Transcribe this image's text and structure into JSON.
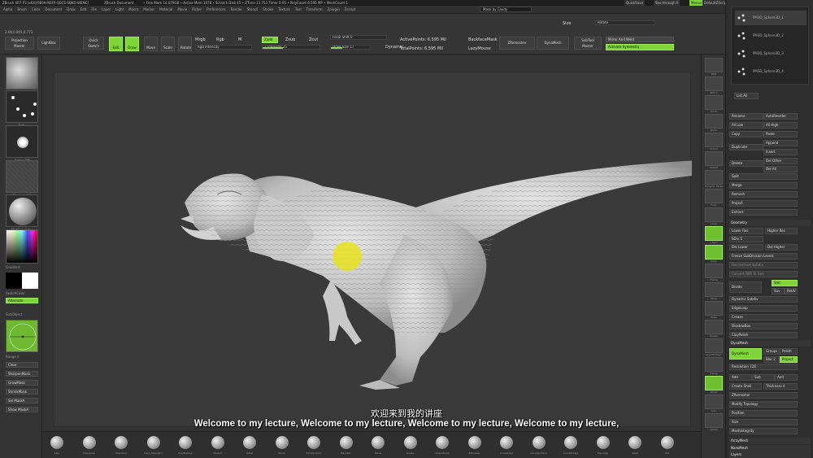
{
  "titlebar": {
    "app": "ZBrush 4R7 P3 (x64)[9E0H-NSFP-Q0CS-SQKO-WEMC]",
    "doc": "ZBrush Document",
    "stats": "• Free Mem 14.079GB • Active Mem 1078 • Scratch Disk 45 • ZTime 13.753 Timer 0.05 • PolyCount 6.595 MP • MeshCount 1",
    "quicksave": "QuickSave",
    "seethrough": "See-through  0",
    "menus": "Menus",
    "default_zscript": "DefaultZScript"
  },
  "menubar": {
    "items": [
      "Alpha",
      "Brush",
      "Color",
      "Document",
      "Draw",
      "Edit",
      "File",
      "Layer",
      "Light",
      "Macro",
      "Marker",
      "Material",
      "Movie",
      "Picker",
      "Preferences",
      "Render",
      "Stencil",
      "Stroke",
      "Texture",
      "Tool",
      "Transform",
      "Zplugin",
      "Zscript"
    ],
    "lightbox": "Home Page",
    "toggle": "Mask by Cavity"
  },
  "shelf": {
    "projection_master": "Projection Master",
    "lightbox": "LightBox",
    "quick_sketch": "Quick Sketch",
    "edit": "Edit",
    "draw": "Draw",
    "move": "Move",
    "scale": "Scale",
    "rotate": "Rotate",
    "mrgb": "Mrgb",
    "rgb": "Rgb",
    "m": "M",
    "zadd": "Zadd",
    "zsub": "Zsub",
    "zcut": "Zcut",
    "rgb_intensity": "Rgb Intensity",
    "z_intensity": "Z Intensity 25",
    "focal_shift": "Focal Shift 0",
    "draw_size": "Draw Size 17",
    "dynamic": "Dynamic",
    "active_points": "ActivePoints: 6.595 Mil",
    "total_points": "TotalPoints: 6.595 Mil",
    "backface_mask": "BackfaceMask",
    "lazy_mouse": "LazyMouse",
    "zremesher": "ZRemesher",
    "dynamesh": "DynaMesh",
    "subtool_master": "SubTool Master",
    "mirror_weld": "Mirror And Weld",
    "activate_symmetry": "Activate Symmetry",
    "size": "Size",
    "rotate_label": "Rotate",
    "coords": "2.08,0.891,0.773"
  },
  "lefttray": {
    "brush": "Standard",
    "stroke": "Dots",
    "alpha": "Alpha Off",
    "texture": "Texture Off",
    "material": "MatCap Gray",
    "gradient": "Gradient",
    "switch_color": "SwitchColor",
    "alternate": "Alternate",
    "subobject": "SubObject",
    "range": "Range 0",
    "buttons": [
      "Clear",
      "SharpenMask",
      "GrowMask",
      "ShrinkMask",
      "Sel MaskA",
      "Show MaskA"
    ]
  },
  "rshelf": {
    "labels": [
      "BPR",
      "SPix 3",
      "Scroll",
      "Zoom",
      "Actual",
      "AAHalf",
      "Dynamic Persp",
      "Floor",
      "Local",
      "L.Sym",
      "Gxyz",
      "Frame",
      "Move",
      "Scale",
      "Rotate",
      "Line Fill PolyF",
      "Transp",
      "Ghost",
      "Solo",
      "Xpose"
    ]
  },
  "palette": {
    "subtools": [
      "PM3D_Sphere3D_1",
      "PM3D_Sphere3D_2",
      "PM3D_Sphere3D_3",
      "PM3D_Sphere3D_4"
    ],
    "list_all": "List All",
    "rename": "Rename",
    "autoreorder": "AutoReorder",
    "all_low": "All Low",
    "all_high": "All High",
    "copy": "Copy",
    "paste": "Paste",
    "append": "Append",
    "duplicate": "Duplicate",
    "insert": "Insert",
    "delete": "Delete",
    "del_other": "Del Other",
    "del_all": "Del All",
    "split": "Split",
    "merge": "Merge",
    "remesh": "Remesh",
    "project": "Project",
    "extract": "Extract",
    "geometry": "Geometry",
    "higher_res": "Higher Res",
    "lower_res": "Lower Res",
    "sdiv": "SDiv 5",
    "del_lower": "Del Lower",
    "del_higher": "Del Higher",
    "freeze_subdiv": "Freeze SubDivision Levels",
    "reconstruct": "Reconstruct Subdiv",
    "convert_bpr": "Convert BPR To Geo",
    "divide": "Divide",
    "smt": "Smt",
    "suv": "Suv",
    "rsuv": "ReUV",
    "dynamic_subdiv": "Dynamic Subdiv",
    "edgeloop": "EdgeLoop",
    "crease": "Crease",
    "shadowbox": "ShadowBox",
    "claypolish": "ClayPolish",
    "dynamesh_head": "DynaMesh",
    "dynamesh": "DynaMesh",
    "groups": "Groups",
    "polish": "Polish",
    "blur": "Blur 2",
    "project_btn": "Project",
    "resolution": "Resolution 128",
    "add": "Add",
    "sub": "Sub",
    "and": "And",
    "create_shell": "Create Shell",
    "thickness": "Thickness 4",
    "zremesher": "ZRemesher",
    "modify_topology": "Modify Topology",
    "position": "Position",
    "size": "Size",
    "meshintegrity": "MeshIntegrity",
    "arraymesh": "ArrayMesh",
    "nanomesh": "NanoMesh",
    "layers": "Layers"
  },
  "brushbar": {
    "brushes": [
      "Clay",
      "Transpose",
      "Standard",
      "Dam_Standard",
      "ClayBuildup",
      "hPolish",
      "Inflat",
      "Pinch",
      "TrimDynamic",
      "MaskPen",
      "Move",
      "Snake",
      "SnakeHook",
      "ZModeler",
      "CurveTube",
      "CurveSurface",
      "CurveBridge",
      "Topology",
      "Slash",
      "Orb"
    ]
  },
  "subtitles": {
    "cn": "欢迎来到我的讲座",
    "en": "Welcome to my lecture, Welcome to my lecture, Welcome to my lecture, Welcome to my lecture,"
  },
  "colors": {
    "accent": "#7fd43a",
    "brush_cursor": "#e8e21e",
    "model": "#d9d9d9"
  }
}
